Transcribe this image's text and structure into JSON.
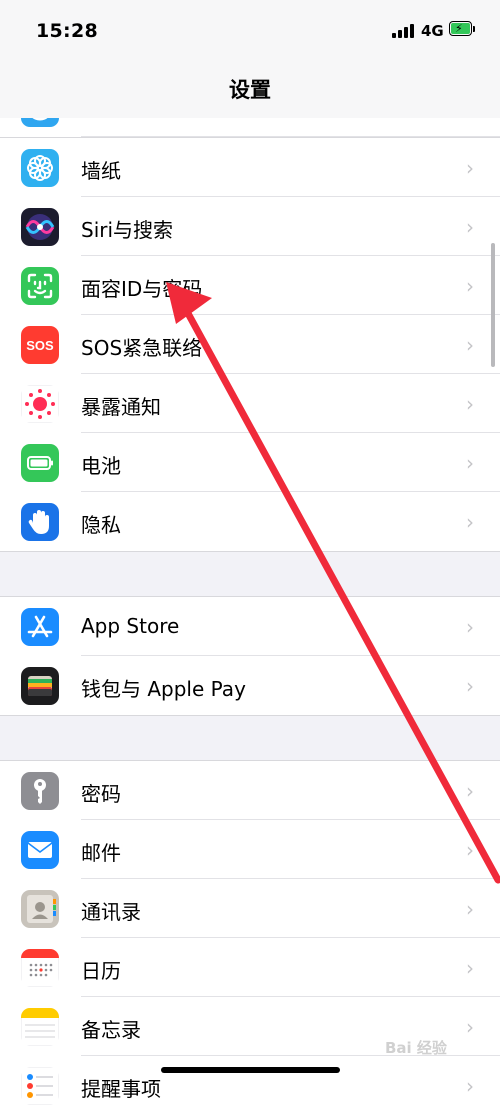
{
  "status_bar": {
    "time": "15:28",
    "network": "4G",
    "battery_icon": "battery-charging-icon",
    "signal_icon": "signal-bars-icon"
  },
  "nav": {
    "title": "设置"
  },
  "groups": [
    {
      "items": [
        {
          "label": "墙纸",
          "icon": "wallpaper-icon",
          "color": "#2fb0f0"
        },
        {
          "label": "Siri与搜索",
          "icon": "siri-icon",
          "color": "#1c1c2e"
        },
        {
          "label": "面容ID与密码",
          "icon": "face-id-icon",
          "color": "#34c759"
        },
        {
          "label": "SOS紧急联络",
          "icon": "sos-icon",
          "color": "#ff3b30"
        },
        {
          "label": "暴露通知",
          "icon": "exposure-notification-icon",
          "color": "#ff2d55"
        },
        {
          "label": "电池",
          "icon": "battery-icon",
          "color": "#34c759"
        },
        {
          "label": "隐私",
          "icon": "privacy-hand-icon",
          "color": "#1a73e8"
        }
      ]
    },
    {
      "items": [
        {
          "label": "App Store",
          "icon": "app-store-icon",
          "color": "#1a8cff"
        },
        {
          "label": "钱包与 Apple Pay",
          "icon": "wallet-icon",
          "color": "#1c1c1e"
        }
      ]
    },
    {
      "items": [
        {
          "label": "密码",
          "icon": "key-icon",
          "color": "#8e8e93"
        },
        {
          "label": "邮件",
          "icon": "mail-icon",
          "color": "#1a8cff"
        },
        {
          "label": "通讯录",
          "icon": "contacts-icon",
          "color": "#c8c3bb"
        },
        {
          "label": "日历",
          "icon": "calendar-icon",
          "color": "#ff3b30"
        },
        {
          "label": "备忘录",
          "icon": "notes-icon",
          "color": "#ffcc00"
        },
        {
          "label": "提醒事项",
          "icon": "reminders-icon",
          "color": "#ff9500"
        }
      ]
    }
  ],
  "chevron": "›",
  "watermark": "Bai 经验",
  "annotation": {
    "icon": "red-arrow-annotation-icon",
    "color": "#f02a3a"
  }
}
